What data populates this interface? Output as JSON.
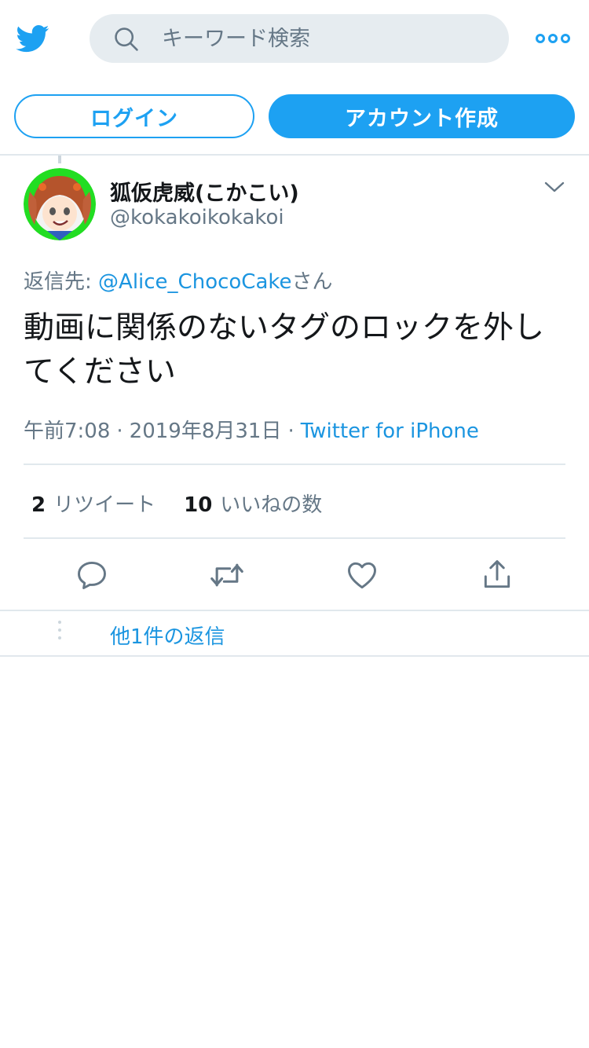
{
  "header": {
    "search_placeholder": "キーワード検索",
    "login_label": "ログイン",
    "signup_label": "アカウント作成"
  },
  "tweet": {
    "display_name": "狐仮虎威(こかこい)",
    "username": "@kokakoikokakoi",
    "reply_prefix": "返信先: ",
    "reply_mention": "@Alice_ChocoCake",
    "reply_suffix": "さん",
    "text": "動画に関係のないタグのロックを外してください",
    "time": "午前7:08",
    "date": "2019年8月31日",
    "source": "Twitter for iPhone",
    "retweet_count": "2",
    "retweet_label": "リツイート",
    "like_count": "10",
    "like_label": "いいねの数"
  },
  "thread": {
    "more_replies": "他1件の返信"
  },
  "colors": {
    "brand": "#1da1f2",
    "link": "#1b95e0",
    "secondary_text": "#657786",
    "search_bg": "#e6ecf0"
  },
  "icons": {
    "logo": "twitter-bird-icon",
    "search": "search-icon",
    "more": "more-dots-icon",
    "caret": "chevron-down-icon",
    "reply": "reply-icon",
    "retweet": "retweet-icon",
    "like": "heart-icon",
    "share": "share-icon"
  }
}
